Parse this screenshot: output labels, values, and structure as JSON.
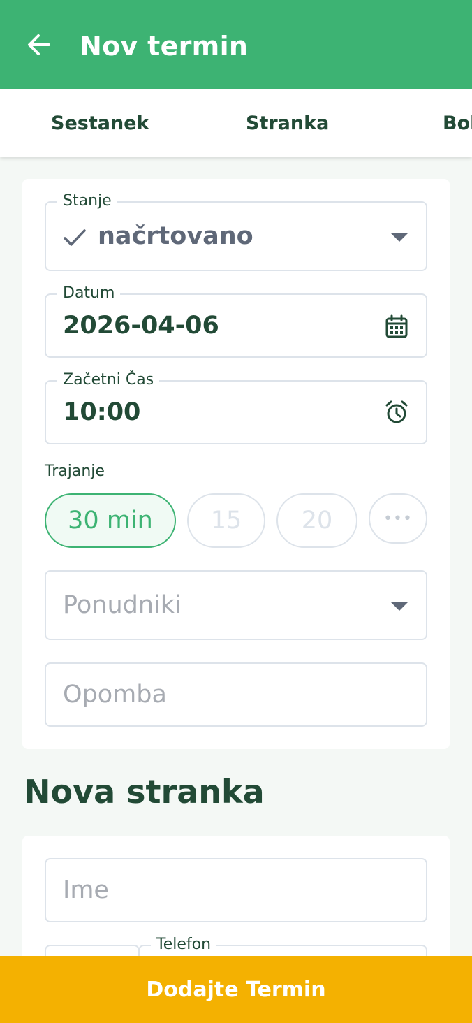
{
  "appbar": {
    "title": "Nov termin"
  },
  "tabs": [
    {
      "label": "Sestanek"
    },
    {
      "label": "Stranka"
    },
    {
      "label": "Bol"
    }
  ],
  "appointment": {
    "status": {
      "label": "Stanje",
      "value": "načrtovano"
    },
    "date": {
      "label": "Datum",
      "value": "2026-04-06"
    },
    "start_time": {
      "label": "Začetni Čas",
      "value": "10:00"
    },
    "duration": {
      "label": "Trajanje",
      "options": [
        {
          "label": "30 min",
          "selected": true
        },
        {
          "label": "15",
          "selected": false
        },
        {
          "label": "20",
          "selected": false
        },
        {
          "label": "•••",
          "selected": false
        }
      ]
    },
    "providers": {
      "placeholder": "Ponudniki"
    },
    "note": {
      "placeholder": "Opomba"
    }
  },
  "new_client": {
    "title": "Nova stranka",
    "name": {
      "placeholder": "Ime"
    },
    "phone": {
      "label": "Telefon"
    }
  },
  "submit": {
    "label": "Dodajte Termin"
  },
  "colors": {
    "primary": "#3db373",
    "accent": "#f4b101",
    "text": "#224a36",
    "border": "#dde3ea",
    "placeholder": "#a7abb2"
  },
  "icons": {
    "back": "arrow-left-icon",
    "status": "check-icon",
    "date": "calendar-icon",
    "time": "alarm-clock-icon",
    "dropdown": "caret-down-icon"
  }
}
